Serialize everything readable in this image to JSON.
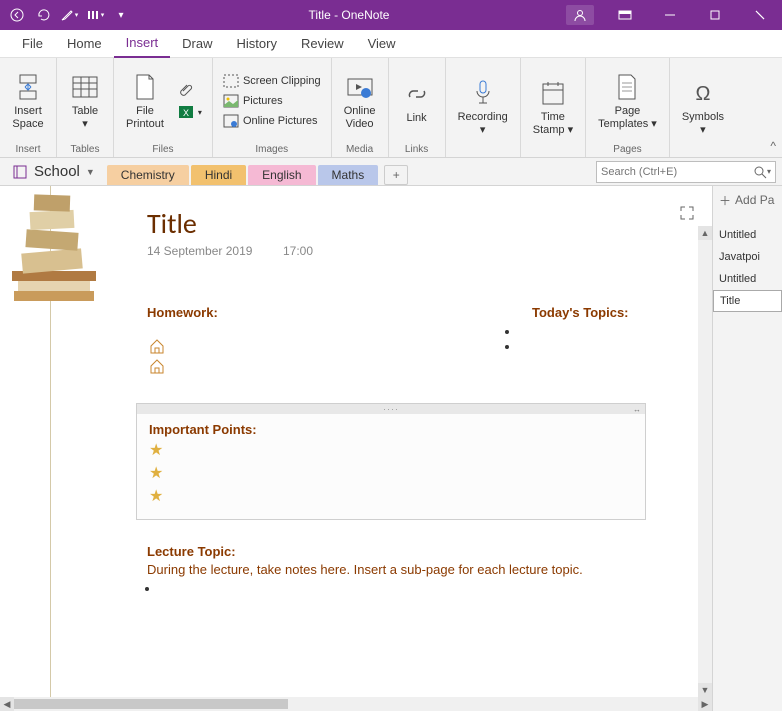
{
  "window": {
    "title": "Title - OneNote"
  },
  "menu": {
    "tabs": [
      "File",
      "Home",
      "Insert",
      "Draw",
      "History",
      "Review",
      "View"
    ],
    "active": 2
  },
  "ribbon": {
    "groups": [
      {
        "label": "Insert",
        "items": [
          {
            "label": "Insert\nSpace"
          }
        ]
      },
      {
        "label": "Tables",
        "items": [
          {
            "label": "Table"
          }
        ]
      },
      {
        "label": "Files",
        "items": [
          {
            "label": "File\nPrintout"
          }
        ],
        "side": [
          "spreadsheet",
          "attach"
        ]
      },
      {
        "label": "Images",
        "items": [
          {
            "label": "Screen Clipping"
          },
          {
            "label": "Pictures"
          },
          {
            "label": "Online Pictures"
          }
        ]
      },
      {
        "label": "Media",
        "items": [
          {
            "label": "Online\nVideo"
          }
        ]
      },
      {
        "label": "Links",
        "items": [
          {
            "label": "Link"
          }
        ]
      },
      {
        "label": "",
        "items": [
          {
            "label": "Recording"
          }
        ]
      },
      {
        "label": "",
        "items": [
          {
            "label": "Time\nStamp"
          }
        ]
      },
      {
        "label": "Pages",
        "items": [
          {
            "label": "Page\nTemplates"
          }
        ]
      },
      {
        "label": "",
        "items": [
          {
            "label": "Symbols"
          }
        ]
      }
    ]
  },
  "notebook": {
    "name": "School",
    "sections": [
      {
        "label": "Chemistry",
        "color": "#f6cfa1"
      },
      {
        "label": "Hindi",
        "color": "#f2c16e"
      },
      {
        "label": "English",
        "color": "#f5b9d4"
      },
      {
        "label": "Maths",
        "color": "#b9c7ea"
      }
    ],
    "activeSection": 3,
    "searchPlaceholder": "Search (Ctrl+E)"
  },
  "pages": {
    "addLabel": "Add Pa",
    "items": [
      "Untitled",
      "Javatpoi",
      "Untitled",
      "Title"
    ],
    "active": 3
  },
  "page": {
    "title": "Title",
    "date": "14 September 2019",
    "time": "17:00",
    "homeworkHeading": "Homework:",
    "topicsHeading": "Today's Topics:",
    "importantHeading": "Important Points:",
    "lectureHeading": "Lecture Topic:",
    "lectureText": "During the lecture, take notes here.  Insert a sub-page for each lecture topic."
  }
}
